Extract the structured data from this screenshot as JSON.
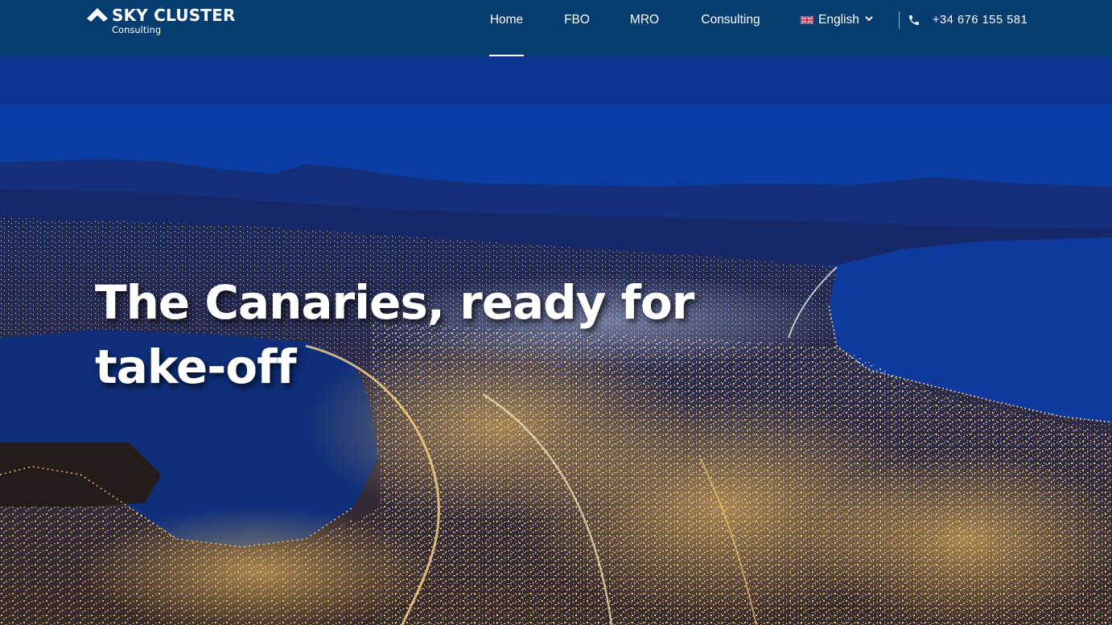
{
  "brand": {
    "name": "SKY CLUSTER",
    "tagline": "Consulting",
    "logo_icon": "chevron-up-icon"
  },
  "nav": {
    "items": [
      {
        "label": "Home",
        "active": true
      },
      {
        "label": "FBO",
        "active": false
      },
      {
        "label": "MRO",
        "active": false
      },
      {
        "label": "Consulting",
        "active": false
      }
    ],
    "language": {
      "label": "English",
      "flag_icon": "uk-flag-icon",
      "dropdown_icon": "chevron-down-icon"
    },
    "phone": {
      "icon": "phone-icon",
      "number": "+34 676 155 581"
    }
  },
  "hero": {
    "title": "The Canaries, ready for take-off"
  },
  "colors": {
    "header_bg": "#053d70",
    "text": "#ffffff",
    "sky": "#0d3c9e",
    "sea": "#0c3178"
  }
}
